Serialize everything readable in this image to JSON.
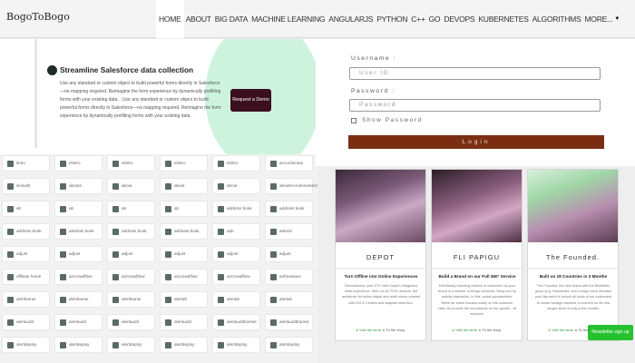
{
  "nav": {
    "brand": "BogoToBogo",
    "items": [
      "HOME",
      "ABOUT",
      "BIG DATA",
      "MACHINE LEARNING",
      "ANGULARJS",
      "PYTHON",
      "C++",
      "GO",
      "DEVOPS",
      "KUBERNETES",
      "ALGORITHMS",
      "MORE..."
    ]
  },
  "ad": {
    "title": "Streamline Salesforce data collection",
    "body": "Use any standard or custom object to build powerful forms directly in Salesforce—no mapping required. Reimagine the form experience by dynamically prefilling forms with your existing data. . Use any standard or custom object to build powerful forms directly in Salesforce—no mapping required. Reimagine the form experience by dynamically prefilling forms with your existing data.",
    "button": "Request a Demo"
  },
  "grid": [
    [
      "lintro",
      "elintro",
      "elintro",
      "elintro",
      "elintro",
      "accordiontax"
    ],
    [
      "sinavdit",
      "abouts",
      "about",
      "about",
      "about",
      "aboutrecruiterwizard"
    ],
    [
      "ab",
      "ab",
      "ab",
      "ab",
      "address book",
      "address book"
    ],
    [
      "address book",
      "address book",
      "address book",
      "address book",
      "ade",
      "adverti"
    ],
    [
      "adjust",
      "adjust",
      "adjust",
      "adjust",
      "adjust",
      "adjust"
    ],
    [
      "affiliate home",
      "aircrowdflow",
      "aircrowdflow",
      "aircrowdflow",
      "aircrowdflow",
      "airfreewave"
    ],
    [
      "alertleaner",
      "alertleaner",
      "alertleaner",
      "alertab",
      "alertab",
      "alertab"
    ],
    [
      "alertaudit",
      "alertaudit",
      "alertaudit",
      "alertaudit",
      "alertaudittracker",
      "alertaudittracker"
    ],
    [
      "alertdeploy",
      "alertdeploy",
      "alertdeploy",
      "alertdeploy",
      "alertdeploy",
      "alertdeploy"
    ]
  ],
  "login": {
    "username_label": "Username :",
    "username_placeholder": "User ID",
    "password_label": "Password :",
    "password_placeholder": "Password",
    "show_password": "Show Password",
    "login_button": "Login"
  },
  "cards": [
    {
      "name": "DEPOT",
      "tagline": "Turn Offline into Online Experiences",
      "desc": "Revolutionize your DTC with Depot's integrated retail experience. With our ACTIVE network, the ambience for online digital and retail stores created with iOS & Clothes and adapted store/tion.",
      "link1": "Visit the store",
      "link2": "To the shop",
      "palette": "purple"
    },
    {
      "name": "FLI PAPIGU",
      "tagline": "Build a Brand on our Full 360° Service",
      "desc": "Effortlessly reaching millions of customers as your brand is a number of things achieved. Bring and by activity brands/ies. In this, social opportunities. While for brand focuses solely on the customer view, we provide the foundations for the growth - all inclusive.",
      "link1": "Visit the store",
      "link2": "To the shop",
      "palette": "rose"
    },
    {
      "name": "The Founded.",
      "tagline": "Built on 18 Countries in 3 Months",
      "desc": "The Founded. the new brand with the Bestseller group (e.g. Brandbolts, and a wrap) have elevated your big world to unlock all kinds of our customers to create footage markets. A moment for all-new ranges since is only a few months.",
      "link1": "Visit the store",
      "link2": "To the shop",
      "palette": "green"
    }
  ],
  "newsletter_button": "Newsletter sign up",
  "colors": {
    "login_button": "#7a2e12",
    "ad_button": "#3b0f1d",
    "ad_blob": "#cdf3de",
    "newsletter": "#27c12f",
    "card_link": "#2e9a3a"
  }
}
